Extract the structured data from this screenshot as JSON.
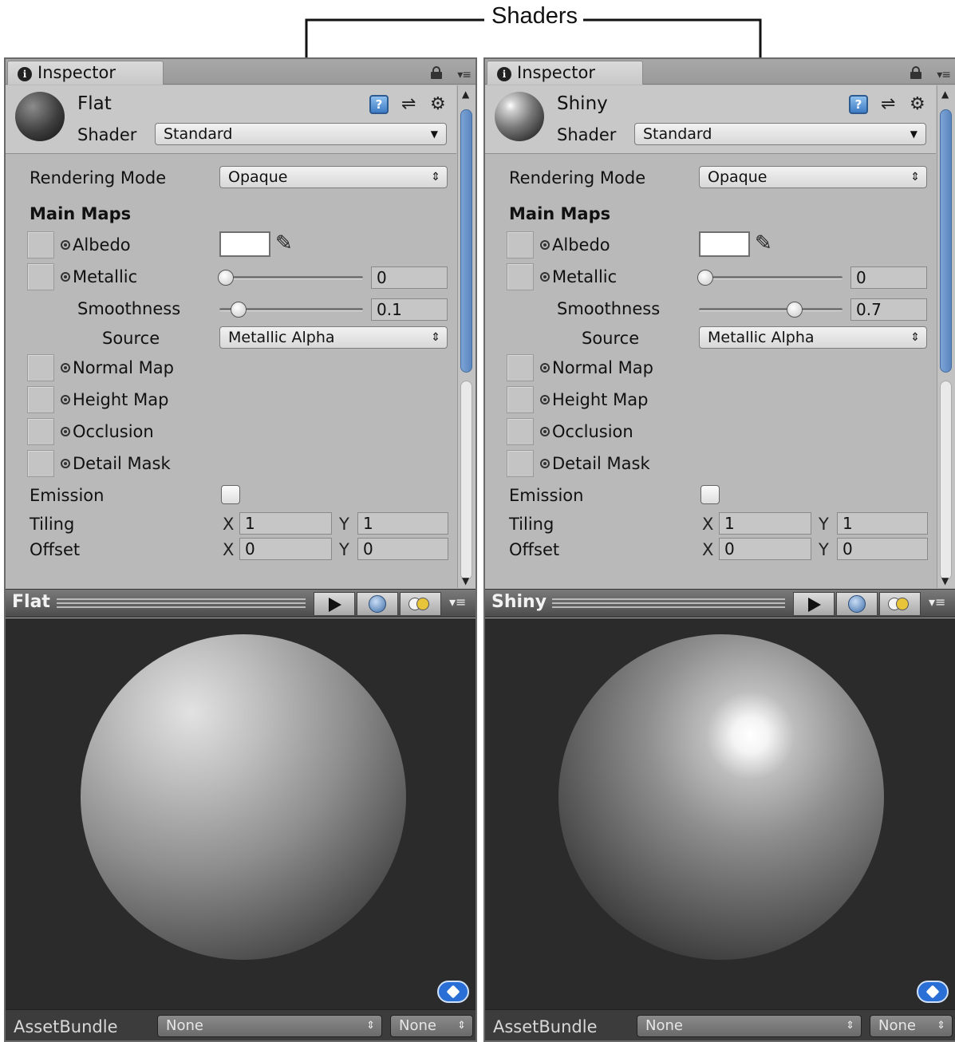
{
  "callout": {
    "label": "Shaders"
  },
  "panels": [
    {
      "tab": "Inspector",
      "material_name": "Flat",
      "shader_label": "Shader",
      "shader_value": "Standard",
      "rendering_mode_label": "Rendering Mode",
      "rendering_mode_value": "Opaque",
      "main_maps_label": "Main Maps",
      "albedo_label": "Albedo",
      "metallic_label": "Metallic",
      "metallic_value": "0",
      "smoothness_label": "Smoothness",
      "smoothness_value": "0.1",
      "source_label": "Source",
      "source_value": "Metallic Alpha",
      "normal_map_label": "Normal Map",
      "height_map_label": "Height Map",
      "occlusion_label": "Occlusion",
      "detail_mask_label": "Detail Mask",
      "emission_label": "Emission",
      "tiling_label": "Tiling",
      "offset_label": "Offset",
      "x_label": "X",
      "y_label": "Y",
      "tiling_x": "1",
      "tiling_y": "1",
      "offset_x": "0",
      "offset_y": "0",
      "preview_title": "Flat",
      "assetbundle_label": "AssetBundle",
      "assetbundle_name": "None",
      "assetbundle_variant": "None",
      "sphere_style": "matte"
    },
    {
      "tab": "Inspector",
      "material_name": "Shiny",
      "shader_label": "Shader",
      "shader_value": "Standard",
      "rendering_mode_label": "Rendering Mode",
      "rendering_mode_value": "Opaque",
      "main_maps_label": "Main Maps",
      "albedo_label": "Albedo",
      "metallic_label": "Metallic",
      "metallic_value": "0",
      "smoothness_label": "Smoothness",
      "smoothness_value": "0.7",
      "source_label": "Source",
      "source_value": "Metallic Alpha",
      "normal_map_label": "Normal Map",
      "height_map_label": "Height Map",
      "occlusion_label": "Occlusion",
      "detail_mask_label": "Detail Mask",
      "emission_label": "Emission",
      "tiling_label": "Tiling",
      "offset_label": "Offset",
      "x_label": "X",
      "y_label": "Y",
      "tiling_x": "1",
      "tiling_y": "1",
      "offset_x": "0",
      "offset_y": "0",
      "preview_title": "Shiny",
      "assetbundle_label": "AssetBundle",
      "assetbundle_name": "None",
      "assetbundle_variant": "None",
      "sphere_style": "glossy"
    }
  ],
  "icons": {
    "tab_info": "info-icon",
    "lock": "lock-icon",
    "help": "help-icon",
    "settings": "settings-icon",
    "gear": "gear-icon",
    "eyedropper": "eyedropper-icon",
    "play": "play-icon",
    "preview_sphere": "sphere-icon",
    "lights": "lights-icon",
    "asset_tag": "tag-icon"
  },
  "colors": {
    "inspector_bg": "#b9b9b9",
    "preview_bg": "#2b2b2b",
    "scroll_thumb": "#6a95cb",
    "asset_tag": "#2a6fd6"
  }
}
